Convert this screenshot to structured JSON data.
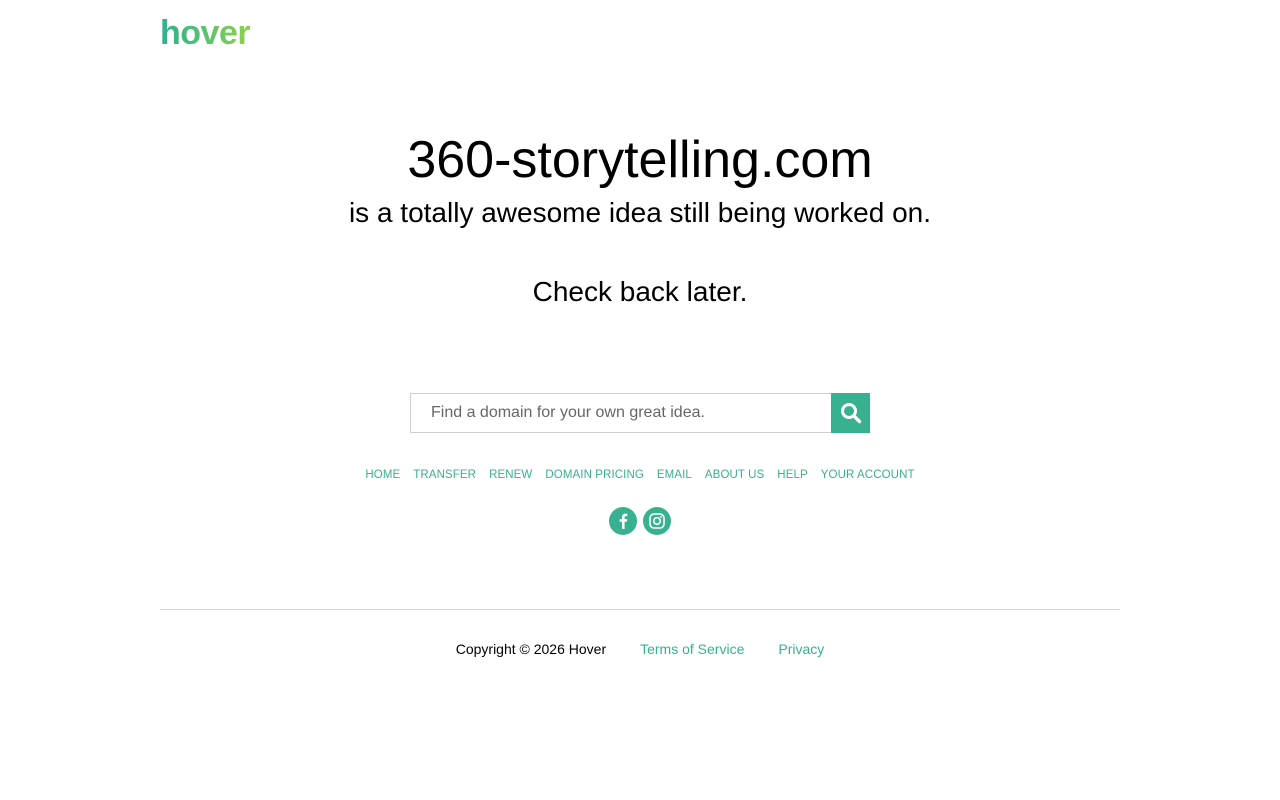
{
  "brand": {
    "logo_text": "hover",
    "accent_color": "#37b18f",
    "logo_gradient": [
      "#2bb28e",
      "#8fd14f"
    ]
  },
  "main": {
    "domain": "360-storytelling.com",
    "tagline": "is a totally awesome idea still being worked on.",
    "checkback": "Check back later."
  },
  "search": {
    "placeholder": "Find a domain for your own great idea.",
    "value": "",
    "button_icon": "search-icon"
  },
  "nav": {
    "items": [
      {
        "label": "HOME"
      },
      {
        "label": "TRANSFER"
      },
      {
        "label": "RENEW"
      },
      {
        "label": "DOMAIN PRICING"
      },
      {
        "label": "EMAIL"
      },
      {
        "label": "ABOUT US"
      },
      {
        "label": "HELP"
      },
      {
        "label": "YOUR ACCOUNT"
      }
    ]
  },
  "social": {
    "items": [
      {
        "icon": "facebook-icon"
      },
      {
        "icon": "instagram-icon"
      }
    ]
  },
  "footer": {
    "copyright": "Copyright © 2026 Hover",
    "terms": "Terms of Service",
    "privacy": "Privacy"
  }
}
